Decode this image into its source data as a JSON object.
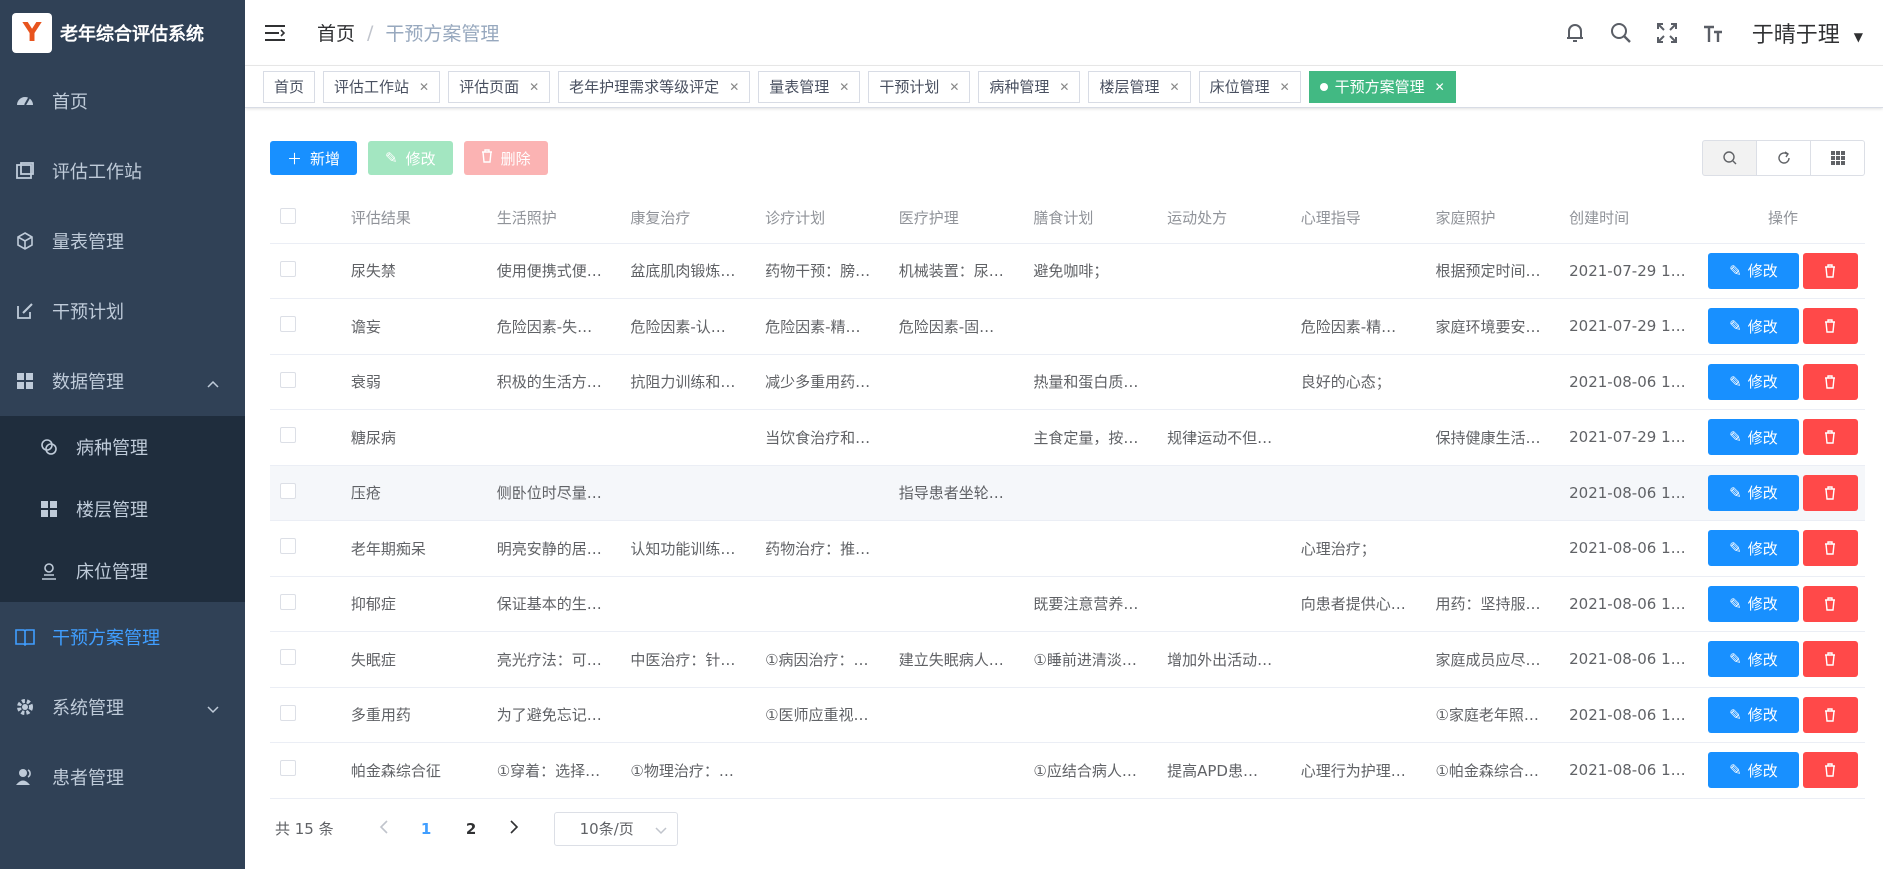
{
  "app": {
    "title": "老年综合评估系统",
    "logo_letter": "Y"
  },
  "sidebar": {
    "items": [
      {
        "label": "首页",
        "icon": "dashboard-icon"
      },
      {
        "label": "评估工作站",
        "icon": "workstation-icon"
      },
      {
        "label": "量表管理",
        "icon": "cube-icon"
      },
      {
        "label": "干预计划",
        "icon": "edit-icon"
      },
      {
        "label": "数据管理",
        "icon": "grid-icon"
      }
    ],
    "submenu": [
      {
        "label": "病种管理",
        "icon": "disease-icon"
      },
      {
        "label": "楼层管理",
        "icon": "grid-icon"
      },
      {
        "label": "床位管理",
        "icon": "bed-icon"
      }
    ],
    "items_after": [
      {
        "label": "干预方案管理",
        "icon": "book-icon"
      },
      {
        "label": "系统管理",
        "icon": "gear-icon"
      },
      {
        "label": "患者管理",
        "icon": "user-icon"
      }
    ]
  },
  "breadcrumb": {
    "home": "首页",
    "sep": "/",
    "current": "干预方案管理"
  },
  "user": {
    "name": "于晴于理"
  },
  "tags": [
    "首页",
    "评估工作站",
    "评估页面",
    "老年护理需求等级评定",
    "量表管理",
    "干预计划",
    "病种管理",
    "楼层管理",
    "床位管理",
    "干预方案管理"
  ],
  "toolbar": {
    "add": "新增",
    "edit": "修改",
    "delete": "删除"
  },
  "table": {
    "headers": [
      "评估结果",
      "生活照护",
      "康复治疗",
      "诊疗计划",
      "医疗护理",
      "膳食计划",
      "运动处方",
      "心理指导",
      "家庭照护",
      "创建时间",
      "操作"
    ],
    "edit_label": "修改",
    "rows": [
      [
        "尿失禁",
        "使用便携式便…",
        "盆底肌肉锻炼…",
        "药物干预：膀…",
        "机械装置：尿…",
        "避免咖啡；",
        "",
        "",
        "根据预定时间…",
        "2021-07-29 1…"
      ],
      [
        "谵妄",
        "危险因素-失…",
        "危险因素-认…",
        "危险因素-精…",
        "危险因素-固…",
        "",
        "",
        "危险因素-精…",
        "家庭环境要安…",
        "2021-07-29 1…"
      ],
      [
        "衰弱",
        "积极的生活方…",
        "抗阻力训练和…",
        "减少多重用药…",
        "",
        "热量和蛋白质…",
        "",
        "良好的心态；",
        "",
        "2021-08-06 1…"
      ],
      [
        "糖尿病",
        "",
        "",
        "当饮食治疗和…",
        "",
        "主食定量，按…",
        "规律运动不但…",
        "",
        "保持健康生活…",
        "2021-07-29 1…"
      ],
      [
        "压疮",
        "侧卧位时尽量…",
        "",
        "",
        "指导患者坐轮…",
        "",
        "",
        "",
        "",
        "2021-08-06 1…"
      ],
      [
        "老年期痴呆",
        "明亮安静的居…",
        "认知功能训练…",
        "药物治疗：推…",
        "",
        "",
        "",
        "心理治疗；",
        "",
        "2021-08-06 1…"
      ],
      [
        "抑郁症",
        "保证基本的生…",
        "",
        "",
        "",
        "既要注意营养…",
        "",
        "向患者提供心…",
        "用药：坚持服…",
        "2021-08-06 1…"
      ],
      [
        "失眠症",
        "亮光疗法：可…",
        "中医治疗：针…",
        "①病因治疗：…",
        "建立失眠病人…",
        "①睡前进清淡…",
        "增加外出活动…",
        "",
        "家庭成员应尽…",
        "2021-08-06 1…"
      ],
      [
        "多重用药",
        "为了避免忘记…",
        "",
        "①医师应重视…",
        "",
        "",
        "",
        "",
        "①家庭老年照…",
        "2021-08-06 1…"
      ],
      [
        "帕金森综合征",
        "①穿着：选择…",
        "①物理治疗：…",
        "",
        "",
        "①应结合病人…",
        "提高APD患…",
        "心理行为护理…",
        "①帕金森综合…",
        "2021-08-06 1…"
      ]
    ]
  },
  "pagination": {
    "total": "共 15 条",
    "pages": [
      "1",
      "2"
    ],
    "current": "1",
    "page_size": "10条/页"
  },
  "colors": {
    "sidebar": "#304156",
    "primary": "#1890ff",
    "success": "#42b983",
    "danger": "#ff4949",
    "active_menu": "#409eff"
  }
}
